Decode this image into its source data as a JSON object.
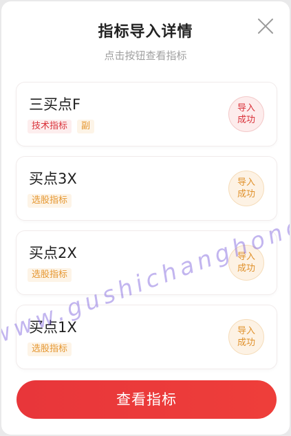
{
  "dialog": {
    "title": "指标导入详情",
    "subtitle": "点击按钮查看指标",
    "close_icon": "close-icon"
  },
  "items": [
    {
      "name": "三买点F",
      "tags": [
        "技术指标",
        "副"
      ],
      "status_line1": "导入",
      "status_line2": "成功",
      "status_color": "#d9323a"
    },
    {
      "name": "买点3X",
      "tags": [
        "选股指标"
      ],
      "status_line1": "导入",
      "status_line2": "成功",
      "status_color": "#e0912b"
    },
    {
      "name": "买点2X",
      "tags": [
        "选股指标"
      ],
      "status_line1": "导入",
      "status_line2": "成功",
      "status_color": "#e0912b"
    },
    {
      "name": "买点1X",
      "tags": [
        "选股指标"
      ],
      "status_line1": "导入",
      "status_line2": "成功",
      "status_color": "#e0912b"
    }
  ],
  "footer": {
    "view_button_label": "查看指标"
  },
  "watermark": "www.gushichanghong.com",
  "colors": {
    "accent": "#e8363a",
    "tag_orange": "#e5962f"
  }
}
